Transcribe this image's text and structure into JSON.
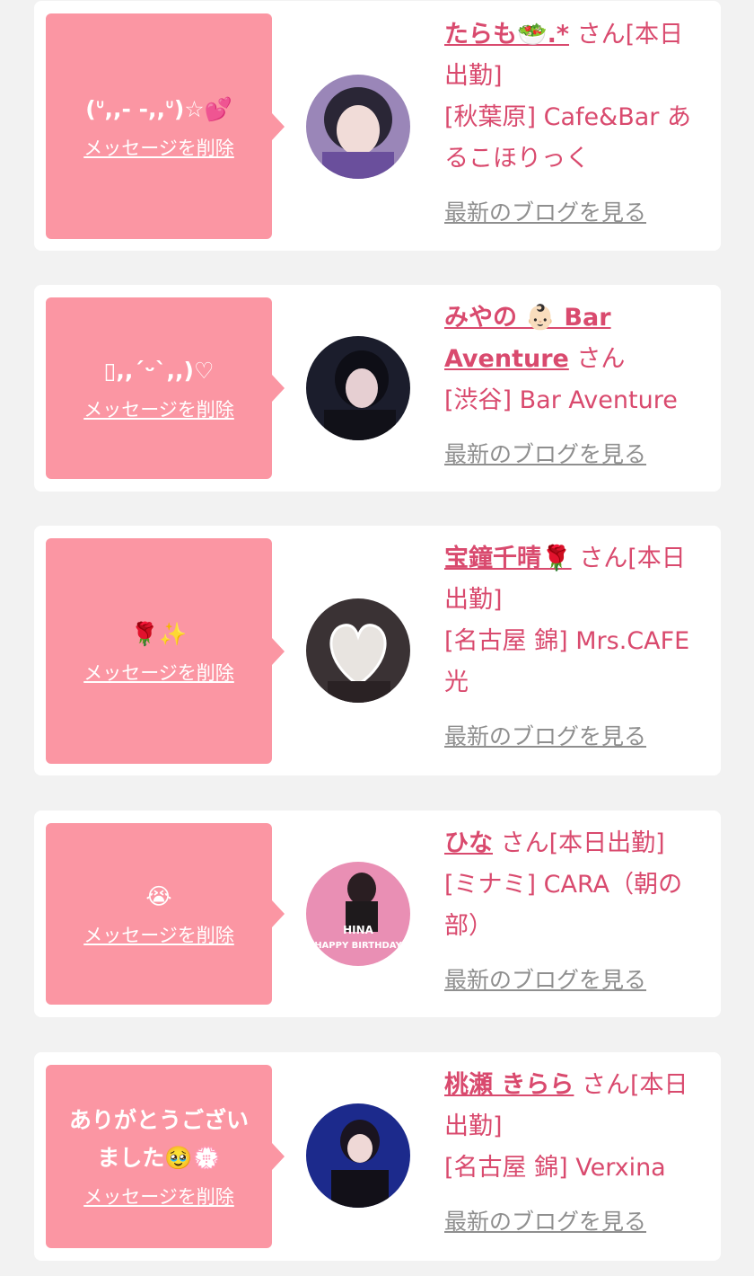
{
  "delete_label": "メッセージを削除",
  "blog_label": "最新のブログを見る",
  "cards": [
    {
      "message": "(ᐡ,,- -,,ᐡ)☆💕",
      "name": "たらも🥗.*",
      "suffix": " さん[本日出勤]",
      "shop": "[秋葉原] Cafe&Bar あるこほりっく"
    },
    {
      "message": "▯,,ˊᵕˋ,,)♡",
      "name": "みやの 👶🏻 Bar Aventure",
      "suffix": " さん",
      "shop": "[渋谷] Bar Aventure"
    },
    {
      "message": "🌹✨",
      "name": "宝鐘千晴🌹",
      "suffix": " さん[本日出勤]",
      "shop": "[名古屋 錦] Mrs.CAFE 光"
    },
    {
      "message": "😭",
      "name": "ひな",
      "suffix": " さん[本日出勤]",
      "shop": "[ミナミ] CARA（朝の部）"
    },
    {
      "message": "ありがとうございました🥹💮",
      "name": "桃瀬 きらら",
      "suffix": " さん[本日出勤]",
      "shop": "[名古屋 錦] Verxina"
    }
  ],
  "avatar_overlay": {
    "title": "HINA",
    "subtitle": "HAPPY BIRTHDAY"
  },
  "colors": {
    "background": "#f2f2f2",
    "bubble": "#fb96a3",
    "name": "#d94a6e",
    "link_gray": "#8f8f8f"
  }
}
